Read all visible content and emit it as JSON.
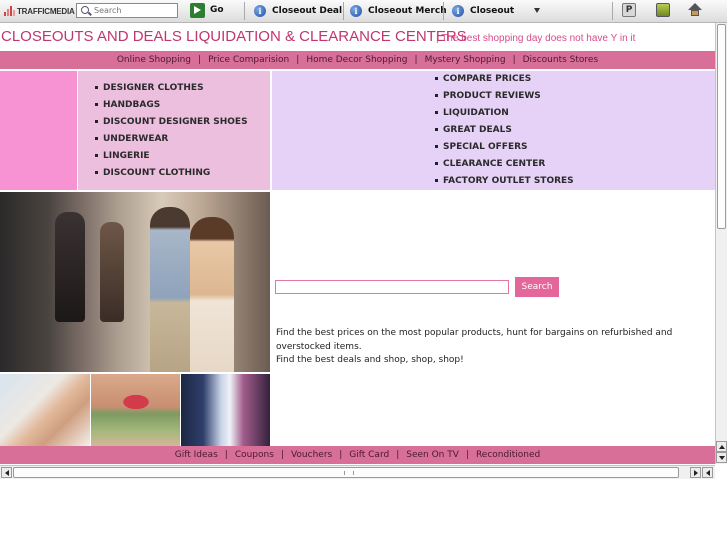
{
  "toolbar": {
    "logo_text": "TRAFFICMEDIA",
    "search_placeholder": "Search",
    "go_label": "Go",
    "items": [
      {
        "label": "Closeout Deal",
        "icon": "info-icon"
      },
      {
        "label": "Closeout Merch",
        "icon": "info-icon"
      },
      {
        "label": "Closeout",
        "icon": "info-icon",
        "dropdown": true
      }
    ],
    "right_icons": [
      "p-icon",
      "mail-icon",
      "home-icon"
    ]
  },
  "header": {
    "title": "CLOSEOUTS AND DEALS LIQUIDATION & CLEARANCE CENTERS",
    "tagline": "| The best shopping day does not have Y in it"
  },
  "nav": {
    "links": [
      "Online Shopping",
      "Price Comparision",
      "Home Decor Shopping",
      "Mystery Shopping",
      "Discounts Stores"
    ],
    "separator": "|"
  },
  "categories": {
    "left": [
      "DESIGNER CLOTHES",
      "HANDBAGS",
      "DISCOUNT DESIGNER SHOES",
      "UNDERWEAR",
      "LINGERIE",
      "DISCOUNT CLOTHING"
    ],
    "right": [
      "COMPARE PRICES",
      "PRODUCT REVIEWS",
      "LIQUIDATION",
      "GREAT DEALS",
      "SPECIAL OFFERS",
      "CLEARANCE CENTER",
      "FACTORY OUTLET STORES"
    ]
  },
  "search": {
    "value": "",
    "button_label": "Search"
  },
  "blurb": {
    "line1": "Find the best prices on the most popular products, hunt for bargains on refurbished and overstocked items.",
    "line2": "Find the best deals and shop, shop, shop!"
  },
  "footer": {
    "links": [
      "Gift Ideas",
      "Coupons",
      "Vouchers",
      "Gift Card",
      "Seen On TV",
      "Reconditioned"
    ],
    "separator": "|"
  },
  "colors": {
    "accent_pink": "#d86f98",
    "title_pink": "#c0366f",
    "bright_pink": "#f792d3",
    "light_pink": "#edbfdf",
    "lavender": "#e6d2f6",
    "button_pink": "#e3679a"
  }
}
